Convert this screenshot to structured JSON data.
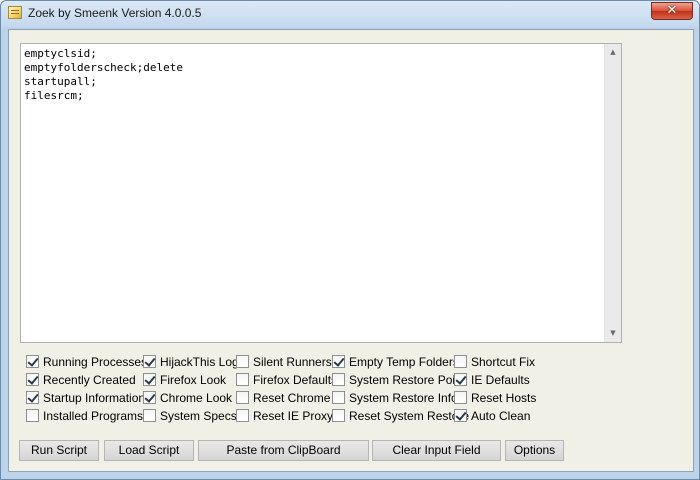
{
  "window": {
    "title": "Zoek by Smeenk Version 4.0.0.5",
    "close_glyph": "✕"
  },
  "script_input": {
    "value": "emptyclsid;\nemptyfolderscheck;delete\nstartupall;\nfilesrcm;"
  },
  "scrollbar": {
    "up_glyph": "▲",
    "down_glyph": "▼"
  },
  "options": [
    {
      "id": "running-processes",
      "label": "Running Processes",
      "checked": true
    },
    {
      "id": "recently-created",
      "label": "Recently Created",
      "checked": true
    },
    {
      "id": "startup-information",
      "label": "Startup Information",
      "checked": true
    },
    {
      "id": "installed-programs",
      "label": "Installed Programs",
      "checked": false
    },
    {
      "id": "hijackthis-log",
      "label": "HijackThis Log",
      "checked": true
    },
    {
      "id": "firefox-look",
      "label": "Firefox Look",
      "checked": true
    },
    {
      "id": "chrome-look",
      "label": "Chrome Look",
      "checked": true
    },
    {
      "id": "system-specs",
      "label": "System Specs",
      "checked": false
    },
    {
      "id": "silent-runners",
      "label": "Silent Runners",
      "checked": false
    },
    {
      "id": "firefox-defaults",
      "label": "Firefox Defaults",
      "checked": false
    },
    {
      "id": "reset-chrome",
      "label": "Reset Chrome",
      "checked": false
    },
    {
      "id": "reset-ie-proxy",
      "label": "Reset IE Proxy",
      "checked": false
    },
    {
      "id": "empty-temp-folders",
      "label": "Empty Temp Folders",
      "checked": true
    },
    {
      "id": "system-restore-point",
      "label": "System Restore Point",
      "checked": false
    },
    {
      "id": "system-restore-info",
      "label": "System Restore Info",
      "checked": false
    },
    {
      "id": "reset-system-restore",
      "label": "Reset System Restore",
      "checked": false
    },
    {
      "id": "shortcut-fix",
      "label": "Shortcut Fix",
      "checked": false
    },
    {
      "id": "ie-defaults",
      "label": "IE Defaults",
      "checked": true
    },
    {
      "id": "reset-hosts",
      "label": "Reset Hosts",
      "checked": false
    },
    {
      "id": "auto-clean",
      "label": "Auto Clean",
      "checked": true
    }
  ],
  "buttons": {
    "run_script": "Run Script",
    "load_script": "Load Script",
    "paste_clipboard": "Paste from ClipBoard",
    "clear_input": "Clear Input Field",
    "options": "Options"
  }
}
